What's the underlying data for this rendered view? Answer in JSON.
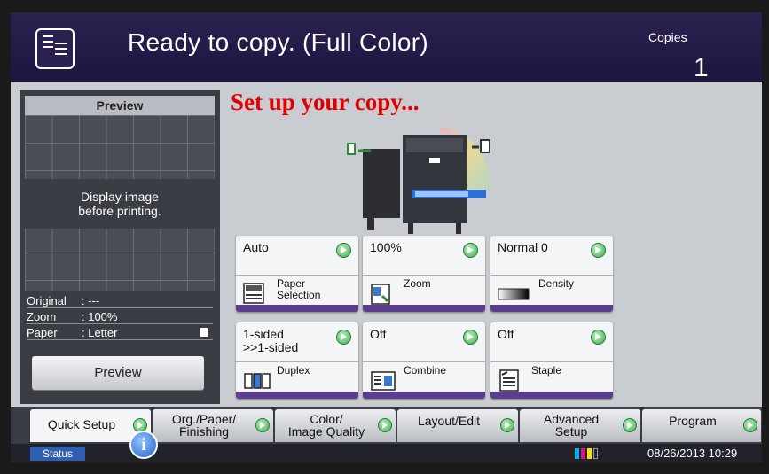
{
  "header": {
    "title": "Ready to copy. (Full Color)",
    "copies_label": "Copies",
    "copies_value": "1"
  },
  "preview_panel": {
    "header": "Preview",
    "message_line1": "Display image",
    "message_line2": "before printing.",
    "info": [
      {
        "label": "Original",
        "value": ": ---"
      },
      {
        "label": "Zoom",
        "value": ": 100%"
      },
      {
        "label": "Paper",
        "value": ": Letter"
      }
    ],
    "preview_button": "Preview"
  },
  "main_title": "Set up your copy...",
  "settings": [
    {
      "value_line1": "Auto",
      "value_line2": "",
      "name_line1": "Paper",
      "name_line2": "Selection",
      "icon": "paper-tray-icon"
    },
    {
      "value_line1": "100%",
      "value_line2": "",
      "name_line1": "Zoom",
      "name_line2": "",
      "icon": "zoom-icon"
    },
    {
      "value_line1": "Normal 0",
      "value_line2": "",
      "name_line1": "Density",
      "name_line2": "",
      "icon": "density-gradient-icon"
    },
    {
      "value_line1": "1-sided",
      "value_line2": ">>1-sided",
      "name_line1": "Duplex",
      "name_line2": "",
      "icon": "duplex-icon"
    },
    {
      "value_line1": "Off",
      "value_line2": "",
      "name_line1": "Combine",
      "name_line2": "",
      "icon": "combine-icon"
    },
    {
      "value_line1": "Off",
      "value_line2": "",
      "name_line1": "Staple",
      "name_line2": "",
      "icon": "staple-icon"
    }
  ],
  "tabs": [
    {
      "line1": "Quick Setup",
      "line2": ""
    },
    {
      "line1": "Org./Paper/",
      "line2": "Finishing"
    },
    {
      "line1": "Color/",
      "line2": "Image Quality"
    },
    {
      "line1": "Layout/Edit",
      "line2": ""
    },
    {
      "line1": "Advanced",
      "line2": "Setup"
    },
    {
      "line1": "Program",
      "line2": ""
    }
  ],
  "statusbar": {
    "status_label": "Status",
    "datetime": "08/26/2013 10:29"
  },
  "colors": {
    "header_bg": "#2b2150",
    "title_red": "#e00000",
    "accent_purple": "#5b3d8e",
    "go_green": "#3fae4d",
    "status_blue": "#2f5fb0"
  }
}
